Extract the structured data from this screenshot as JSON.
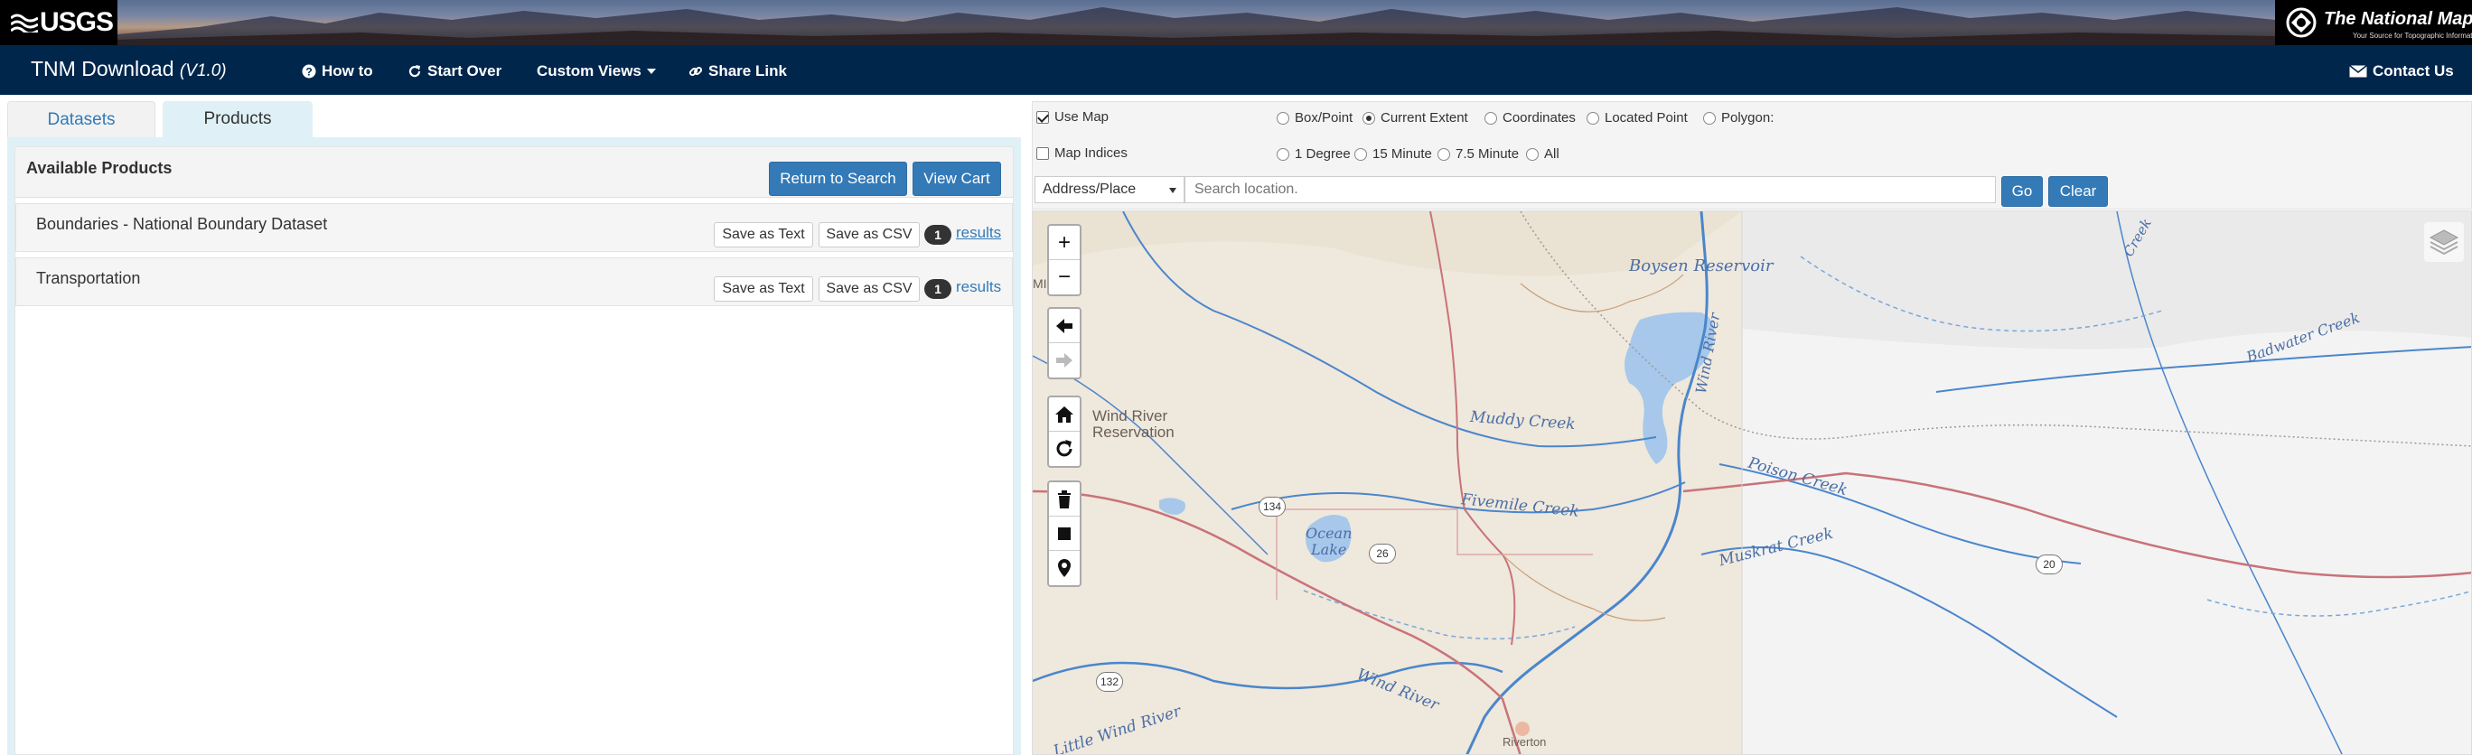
{
  "banner": {
    "usgs_logo": "USGS",
    "tnm_name": "The National Map",
    "tnm_tagline": "Your Source for Topographic Information"
  },
  "navbar": {
    "title": "TNM Download",
    "version": "(V1.0)",
    "links": {
      "how_to": "How to",
      "start_over": "Start Over",
      "custom_views": "Custom Views",
      "share_link": "Share Link",
      "contact_us": "Contact Us"
    }
  },
  "tabs": {
    "datasets": "Datasets",
    "products": "Products",
    "active": "Products"
  },
  "products_panel": {
    "title": "Available Products",
    "return_button": "Return to Search",
    "view_cart_button": "View Cart",
    "rows": [
      {
        "name": "Boundaries - National Boundary Dataset",
        "save_text": "Save as Text",
        "save_csv": "Save as CSV",
        "count": "1",
        "results": "results"
      },
      {
        "name": "Transportation",
        "save_text": "Save as Text",
        "save_csv": "Save as CSV",
        "count": "1",
        "results": "results"
      }
    ]
  },
  "map_controls": {
    "use_map": {
      "label": "Use Map",
      "checked": true
    },
    "map_indices": {
      "label": "Map Indices",
      "checked": false
    },
    "extent_options": [
      {
        "label": "Box/Point",
        "selected": false
      },
      {
        "label": "Current Extent",
        "selected": true
      },
      {
        "label": "Coordinates",
        "selected": false
      },
      {
        "label": "Located Point",
        "selected": false
      },
      {
        "label": "Polygon:",
        "selected": false
      }
    ],
    "index_options": [
      {
        "label": "1 Degree",
        "selected": false
      },
      {
        "label": "15 Minute",
        "selected": false
      },
      {
        "label": "7.5 Minute",
        "selected": false
      },
      {
        "label": "All",
        "selected": false
      }
    ],
    "search_type": "Address/Place",
    "search_placeholder": "Search location.",
    "go_button": "Go",
    "clear_button": "Clear"
  },
  "map": {
    "zoom_in": "+",
    "zoom_out": "−",
    "labels": {
      "boysen": "Boysen Reservoir",
      "wind_river_vertical": "Wind River",
      "badwater": "Badwater Creek",
      "reservation": "Wind River\nReservation",
      "muddy": "Muddy Creek",
      "poison": "Poison Creek",
      "fivemile": "Fivemile Creek",
      "ocean_lake": "Ocean\nLake",
      "muskrat": "Muskrat Creek",
      "wind_river": "Wind River",
      "little_wind": "Little Wind River",
      "riverton": "Riverton",
      "creek_top": "Creek",
      "ming": "MING"
    },
    "shields": {
      "r134": "134",
      "r26": "26",
      "r20": "20",
      "r132": "132"
    }
  },
  "colors": {
    "navbar_bg": "#00264c",
    "primary_button": "#337ab7",
    "panel_bg": "#dff1f6",
    "water": "#a7c8ea",
    "river": "#4a86cc",
    "road": "#c8737a"
  }
}
